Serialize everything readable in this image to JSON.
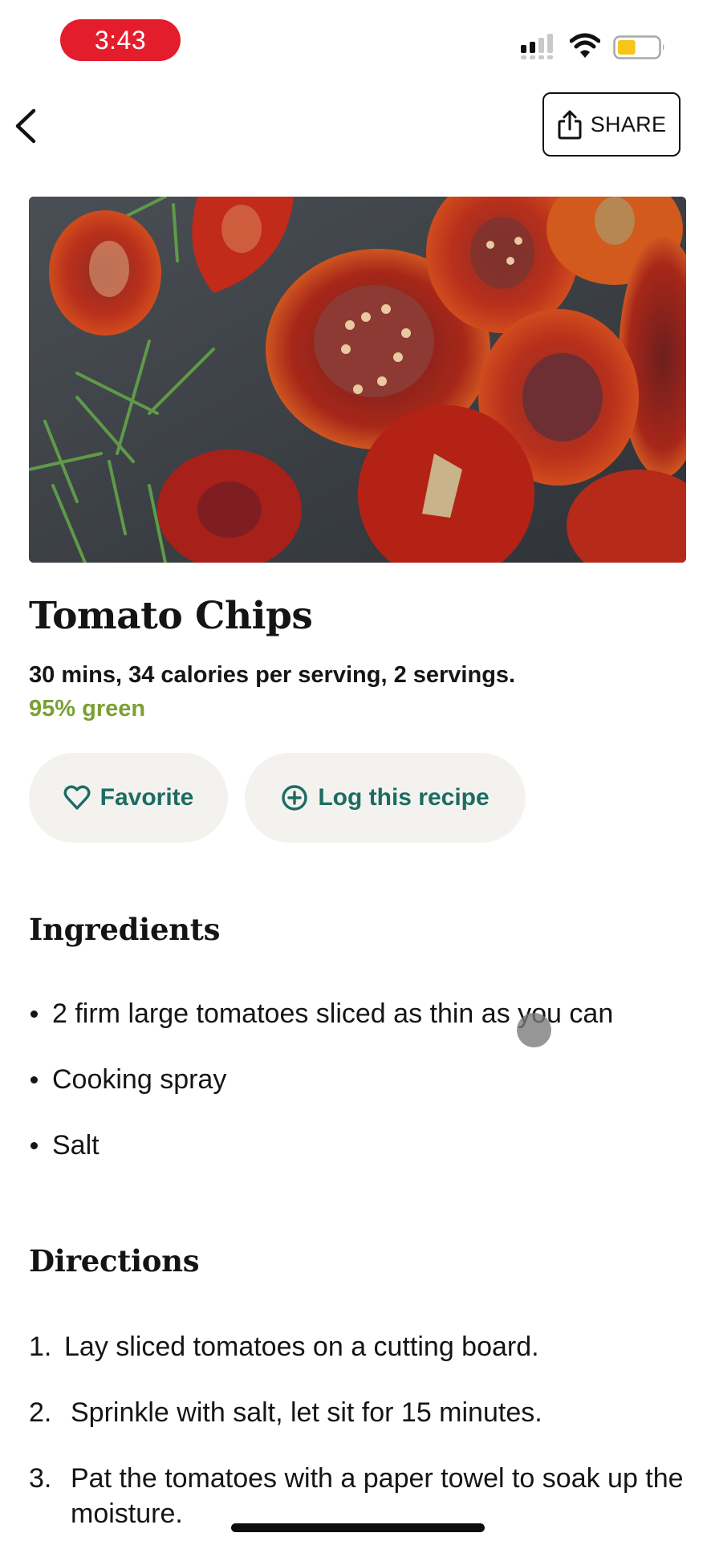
{
  "status_bar": {
    "time": "3:43",
    "time_pill_color": "#e41d2d",
    "signal_bars_active": 2,
    "signal_bars_total": 4,
    "battery_level": 0.45,
    "battery_color": "#f5c518",
    "icons": [
      "cellular-signal-icon",
      "wifi-icon",
      "battery-icon"
    ]
  },
  "nav": {
    "back_icon": "chevron-left-icon",
    "share_label": "SHARE",
    "share_icon": "share-icon"
  },
  "hero": {
    "image_alt": "Sun-dried tomato slices with rosemary sprigs on a dark wooden surface"
  },
  "recipe": {
    "title": "Tomato Chips",
    "meta": "30 mins, 34 calories per serving, 2 servings.",
    "green_score": "95% green",
    "green_color": "#7aa032"
  },
  "actions": {
    "favorite_label": "Favorite",
    "favorite_icon": "heart-outline-icon",
    "log_label": "Log this recipe",
    "log_icon": "plus-circle-icon",
    "accent_color": "#1c6c62"
  },
  "ingredients": {
    "heading": "Ingredients",
    "items": [
      "2 firm large tomatoes sliced as thin as you can",
      "Cooking spray",
      "Salt"
    ]
  },
  "directions": {
    "heading": "Directions",
    "steps": [
      {
        "num": "1.",
        "text": "Lay sliced tomatoes on a cutting board."
      },
      {
        "num": "2.",
        "text": "Sprinkle with salt, let sit for 15 minutes."
      },
      {
        "num": "3.",
        "text": "Pat the tomatoes with a paper towel to soak up the moisture."
      }
    ]
  }
}
